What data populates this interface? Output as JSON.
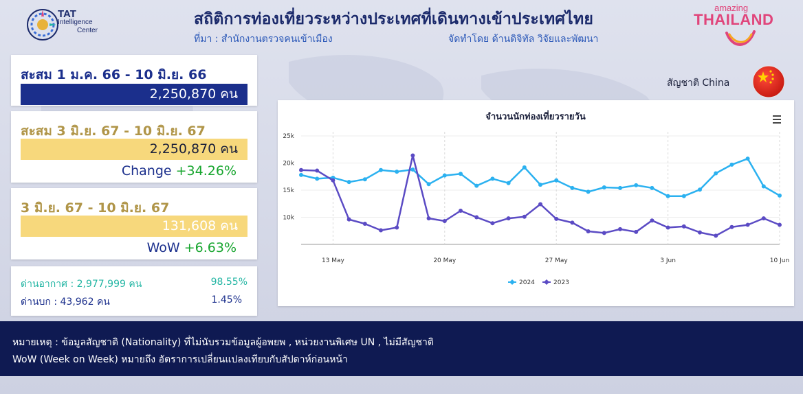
{
  "header": {
    "logo_name": "TAT",
    "logo_line1": "Intelligence",
    "logo_line2": "Center",
    "title": "สถิติการท่องเที่ยวระหว่างประเทศที่เดินทางเข้าประเทศไทย",
    "source": "ที่มา : สำนักงานตรวจคนเข้าเมือง",
    "producer": "จัดทำโดย ด้านดิจิทัล วิจัยและพัฒนา",
    "brand_top": "amazing",
    "brand_main": "THAILAND"
  },
  "kpi": {
    "cumulative_prev": {
      "title": "สะสม 1 ม.ค. 66 - 10 มิ.ย. 66",
      "value": "2,250,870 คน"
    },
    "cumulative_curr": {
      "title": "สะสม 3 มิ.ย. 67 - 10 มิ.ย. 67",
      "value": "2,250,870 คน",
      "change_label": "Change",
      "change_value": "+34.26%"
    },
    "week": {
      "title": "3 มิ.ย. 67 - 10 มิ.ย. 67",
      "value": "131,608 คน",
      "wow_label": "WoW",
      "wow_value": "+6.63%"
    },
    "split": {
      "air_label": "ด่านอากาศ : 2,977,999 คน",
      "air_pct": "98.55%",
      "land_label": "ด่านบก : 43,962 คน",
      "land_pct": "1.45%"
    }
  },
  "nationality": {
    "label": "สัญชาติ China",
    "flag_icon": "china-flag-icon"
  },
  "colors": {
    "series_2024": "#2bb1f0",
    "series_2023": "#5b4bc4",
    "navy": "#1b2f8c",
    "gold": "#f7d87c"
  },
  "chart_data": {
    "type": "line",
    "title": "จำนวนนักท่องเที่ยวรายวัน",
    "ylim": [
      0,
      25000
    ],
    "y_ticks": [
      "10k",
      "15k",
      "20k",
      "25k"
    ],
    "x_ticks": [
      "13 May",
      "20 May",
      "27 May",
      "3 Jun",
      "10 Jun"
    ],
    "x": [
      "9 May",
      "10 May",
      "11 May",
      "12 May",
      "13 May",
      "14 May",
      "15 May",
      "16 May",
      "17 May",
      "18 May",
      "19 May",
      "20 May",
      "21 May",
      "22 May",
      "23 May",
      "24 May",
      "25 May",
      "26 May",
      "27 May",
      "28 May",
      "29 May",
      "30 May",
      "31 May",
      "1 Jun",
      "2 Jun",
      "3 Jun",
      "4 Jun",
      "5 Jun",
      "6 Jun",
      "7 Jun",
      "8 Jun",
      "9 Jun",
      "10 Jun"
    ],
    "series": [
      {
        "name": "2024",
        "values": [
          17800,
          17100,
          17300,
          16500,
          17000,
          18700,
          18400,
          18800,
          16100,
          17700,
          18000,
          15800,
          17100,
          16300,
          19200,
          16000,
          16800,
          15400,
          14700,
          15500,
          15400,
          15900,
          15400,
          13900,
          13900,
          15100,
          18100,
          19700,
          20800,
          15700,
          14000
        ]
      },
      {
        "name": "2023",
        "values": [
          18700,
          18600,
          16800,
          9600,
          8800,
          7600,
          8100,
          21400,
          9800,
          9300,
          11200,
          10000,
          8900,
          9800,
          10100,
          12400,
          9700,
          9000,
          7400,
          7100,
          7800,
          7300,
          9400,
          8100,
          8300,
          7200,
          6600,
          8200,
          8600,
          9800,
          8600
        ]
      }
    ],
    "legend": [
      "2024",
      "2023"
    ],
    "legend_position": "bottom-center"
  },
  "footer": {
    "note1": "หมายเหตุ : ข้อมูลสัญชาติ (Nationality) ที่ไม่นับรวมข้อมูลผู้อพยพ , หน่วยงานพิเศษ UN , ไม่มีสัญชาติ",
    "note2": "WoW (Week on Week) หมายถึง อัตราการเปลี่ยนแปลงเทียบกับสัปดาห์ก่อนหน้า"
  }
}
